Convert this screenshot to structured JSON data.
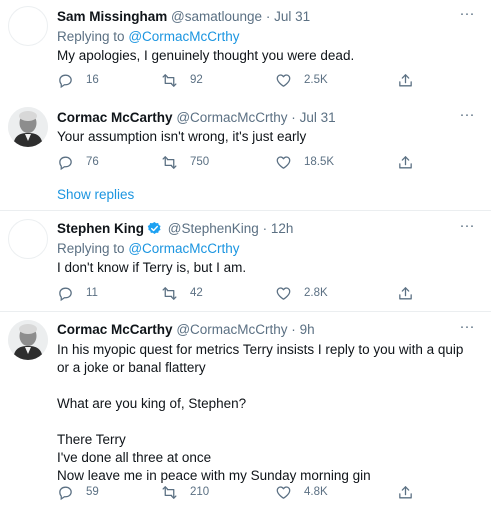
{
  "tweets": [
    {
      "name": "Sam Missingham",
      "handle": "@samatlounge",
      "dot": "·",
      "time": "Jul 31",
      "replying_prefix": "Replying to",
      "replying_to": "@CormacMcCrthy",
      "text": "My apologies, I genuinely thought you were dead.",
      "replies": "16",
      "retweets": "92",
      "likes": "2.5K"
    },
    {
      "name": "Cormac McCarthy",
      "handle": "@CormacMcCrthy",
      "dot": "·",
      "time": "Jul 31",
      "text": "Your assumption isn't wrong, it's just early",
      "replies": "76",
      "retweets": "750",
      "likes": "18.5K"
    },
    {
      "name": "Stephen King",
      "handle": "@StephenKing",
      "dot": "·",
      "time": "12h",
      "replying_prefix": "Replying to",
      "replying_to": "@CormacMcCrthy",
      "text": "I don't know if Terry is, but I am.",
      "replies": "11",
      "retweets": "42",
      "likes": "2.8K"
    },
    {
      "name": "Cormac McCarthy",
      "handle": "@CormacMcCrthy",
      "dot": "·",
      "time": "9h",
      "text": "In his myopic quest for metrics Terry insists I reply to you with a quip or a joke or banal flattery\n\nWhat are you king of, Stephen?\n\nThere Terry\nI've done all three at once\nNow leave me in peace with my Sunday morning gin",
      "replies": "59",
      "retweets": "210",
      "likes": "4.8K"
    }
  ],
  "show_replies": "Show replies",
  "icons": {
    "more": "more-horizontal-icon",
    "reply": "reply-icon",
    "retweet": "retweet-icon",
    "like": "heart-icon",
    "share": "share-icon",
    "verified": "verified-badge-icon"
  },
  "colors": {
    "link": "#1b95e0",
    "muted": "#5b7083",
    "verified": "#1da1f2",
    "divider": "#ebeef0"
  }
}
